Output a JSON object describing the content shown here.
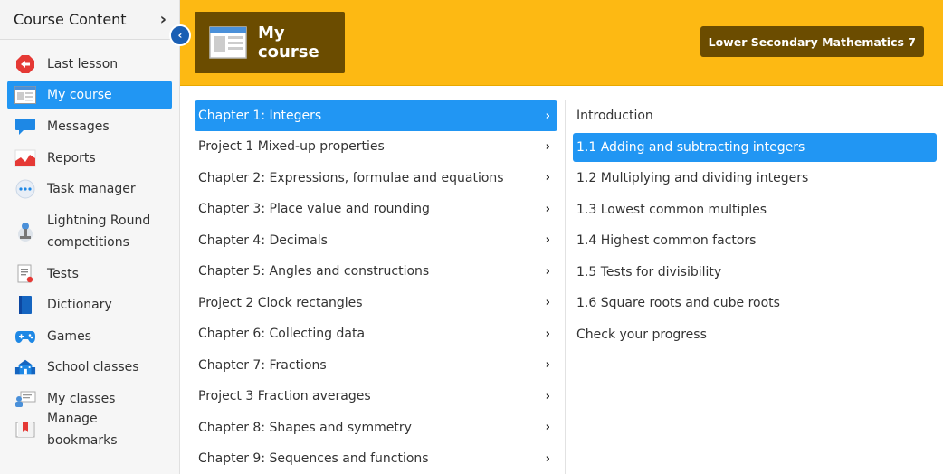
{
  "sidebar": {
    "title": "Course Content",
    "items": [
      {
        "label": "Last lesson",
        "icon": "back-arrow-icon"
      },
      {
        "label": "My course",
        "icon": "course-window-icon",
        "active": true
      },
      {
        "label": "Messages",
        "icon": "chat-bubble-icon"
      },
      {
        "label": "Reports",
        "icon": "chart-icon"
      },
      {
        "label": "Task manager",
        "icon": "task-manager-icon"
      },
      {
        "label": "Lightning Round competitions",
        "icon": "trophy-icon"
      },
      {
        "label": "Tests",
        "icon": "test-sheet-icon"
      },
      {
        "label": "Dictionary",
        "icon": "book-icon"
      },
      {
        "label": "Games",
        "icon": "gamepad-icon"
      },
      {
        "label": "School classes",
        "icon": "school-icon"
      },
      {
        "label": "My classes",
        "icon": "classes-icon"
      },
      {
        "label": "Manage bookmarks",
        "icon": "bookmark-icon"
      }
    ]
  },
  "header": {
    "course_title": "My course",
    "course_name": "Lower Secondary Mathematics 7",
    "accent": "#fdb913",
    "tile_color": "#6b4c00"
  },
  "chapters": [
    {
      "label": "Chapter 1: Integers",
      "active": true
    },
    {
      "label": "Project 1 Mixed-up properties"
    },
    {
      "label": "Chapter 2: Expressions, formulae and equations"
    },
    {
      "label": "Chapter 3: Place value and rounding"
    },
    {
      "label": "Chapter 4: Decimals"
    },
    {
      "label": "Chapter 5: Angles and constructions"
    },
    {
      "label": "Project 2 Clock rectangles"
    },
    {
      "label": "Chapter 6: Collecting data"
    },
    {
      "label": "Chapter 7: Fractions"
    },
    {
      "label": "Project 3 Fraction averages"
    },
    {
      "label": "Chapter 8: Shapes and symmetry"
    },
    {
      "label": "Chapter 9: Sequences and functions"
    }
  ],
  "sections": [
    {
      "label": "Introduction"
    },
    {
      "label": "1.1 Adding and subtracting integers",
      "active": true
    },
    {
      "label": "1.2 Multiplying and dividing integers"
    },
    {
      "label": "1.3 Lowest common multiples"
    },
    {
      "label": "1.4 Highest common factors"
    },
    {
      "label": "1.5 Tests for divisibility"
    },
    {
      "label": "1.6 Square roots and cube roots"
    },
    {
      "label": "Check your progress"
    }
  ],
  "highlight": "#2196f3"
}
